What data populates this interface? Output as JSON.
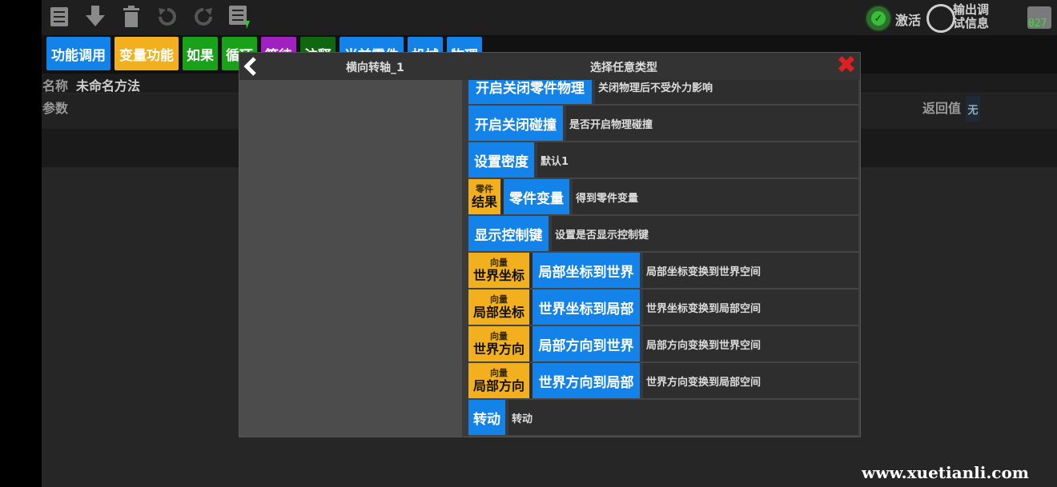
{
  "toolbar": {
    "icons": [
      "list-icon",
      "download-icon",
      "trash-icon",
      "undo-icon",
      "redo-icon",
      "list-run-icon"
    ]
  },
  "status": {
    "activate_label": "激活",
    "debug_label": "输出调试信息",
    "counter": "027"
  },
  "tabs": [
    {
      "label": "功能调用",
      "color": "#1383ea"
    },
    {
      "label": "变量功能",
      "color": "#f2b01e"
    },
    {
      "label": "如果",
      "color": "#1aa11a"
    },
    {
      "label": "循环",
      "color": "#1aa11a"
    },
    {
      "label": "等待",
      "color": "#a020c0"
    },
    {
      "label": "注释",
      "color": "#116611"
    },
    {
      "label": "当前零件",
      "color": "#1383ea"
    },
    {
      "label": "机械",
      "color": "#1383ea"
    },
    {
      "label": "物理",
      "color": "#1383ea"
    }
  ],
  "method": {
    "name_label": "名称",
    "name_value": "未命名方法",
    "params_label": "参数",
    "return_label": "返回值",
    "return_value": "无"
  },
  "modal": {
    "left_title": "横向转轴_1",
    "right_title": "选择任意类型",
    "items": [
      {
        "type_small": "",
        "type_big": "",
        "name": "开启关闭零件物理",
        "desc": "关闭物理后不受外力影响"
      },
      {
        "type_small": "",
        "type_big": "",
        "name": "开启关闭碰撞",
        "desc": "是否开启物理碰撞"
      },
      {
        "type_small": "",
        "type_big": "",
        "name": "设置密度",
        "desc": "默认1"
      },
      {
        "type_small": "零件",
        "type_big": "结果",
        "name": "零件变量",
        "desc": "得到零件变量"
      },
      {
        "type_small": "",
        "type_big": "",
        "name": "显示控制键",
        "desc": "设置是否显示控制键"
      },
      {
        "type_small": "向量",
        "type_big": "世界坐标",
        "name": "局部坐标到世界",
        "desc": "局部坐标变换到世界空间"
      },
      {
        "type_small": "向量",
        "type_big": "局部坐标",
        "name": "世界坐标到局部",
        "desc": "世界坐标变换到局部空间"
      },
      {
        "type_small": "向量",
        "type_big": "世界方向",
        "name": "局部方向到世界",
        "desc": "局部方向变换到世界空间"
      },
      {
        "type_small": "向量",
        "type_big": "局部方向",
        "name": "世界方向到局部",
        "desc": "世界方向变换到局部空间"
      },
      {
        "type_small": "",
        "type_big": "",
        "name": "转动",
        "desc": "转动"
      }
    ]
  },
  "watermark": "www.xuetianli.com"
}
